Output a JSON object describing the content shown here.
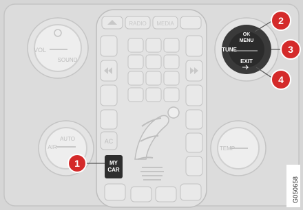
{
  "panel": {
    "left_knob": {
      "top_label": "VOL",
      "bottom_label": "SOUND"
    },
    "right_knob": {
      "ok_label_1": "OK",
      "ok_label_2": "MENU",
      "tune_label": "TUNE",
      "exit_label": "EXIT"
    },
    "center_top_buttons": [
      "RADIO",
      "MEDIA"
    ],
    "climate_buttons": {
      "auto": "AUTO",
      "ac": "AC",
      "air": "AIR",
      "temp": "TEMP"
    },
    "my_car_button": {
      "line1": "MY",
      "line2": "CAR"
    }
  },
  "callouts": [
    {
      "number": "1",
      "color": "#d42a2a"
    },
    {
      "number": "2",
      "color": "#d42a2a"
    },
    {
      "number": "3",
      "color": "#d42a2a"
    },
    {
      "number": "4",
      "color": "#d42a2a"
    }
  ],
  "figure_id": "G050658",
  "colors": {
    "panel_bg": "#d9d9d9",
    "key_face": "#e6e6e6",
    "callout": "#d42a2a",
    "highlight_knob": "#3a3a3a"
  }
}
